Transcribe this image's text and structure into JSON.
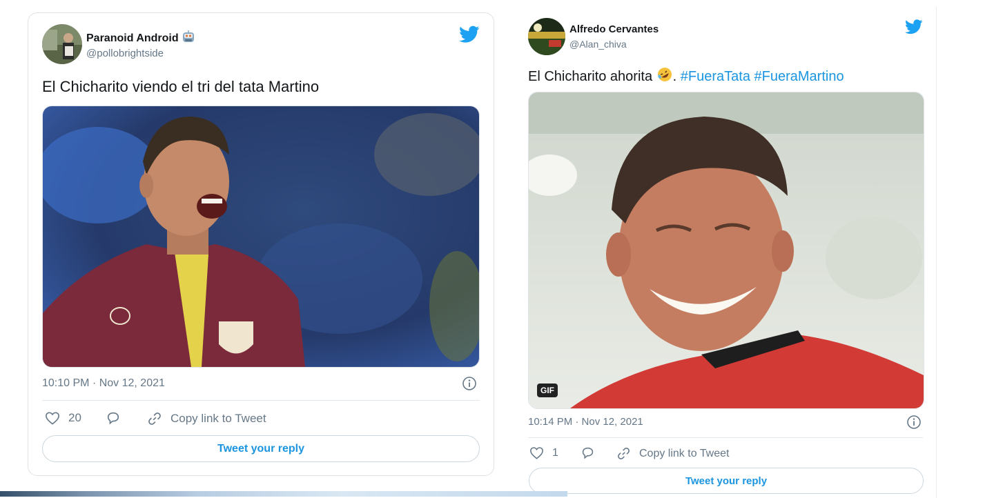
{
  "tweets": [
    {
      "display_name": "Paranoid Android",
      "name_emoji": "robot-emoji",
      "handle": "@pollobrightside",
      "text": "El Chicharito viendo el tri del tata Martino",
      "media": "photo",
      "timestamp": "10:10 PM · Nov 12, 2021",
      "likes": "20",
      "copy_link_label": "Copy link to Tweet",
      "reply_label": "Tweet your reply"
    },
    {
      "display_name": "Alfredo Cervantes",
      "handle": "@Alan_chiva",
      "text_prefix": "El Chicharito ahorita ",
      "text_emoji": "rolling-on-floor-laughing-emoji",
      "text_punct": ". ",
      "hashtags": [
        "#FueraTata",
        "#FueraMartino"
      ],
      "media": "gif",
      "gif_badge": "GIF",
      "timestamp": "10:14 PM · Nov 12, 2021",
      "likes": "1",
      "copy_link_label": "Copy link to Tweet",
      "reply_label": "Tweet your reply"
    }
  ],
  "colors": {
    "twitter_blue": "#1da1f2",
    "link_blue": "#1b95e0",
    "muted_text": "#657786",
    "border": "#dfe3e7"
  },
  "icons": [
    "twitter-bird-icon",
    "info-icon",
    "heart-icon",
    "reply-bubble-icon",
    "link-icon"
  ]
}
